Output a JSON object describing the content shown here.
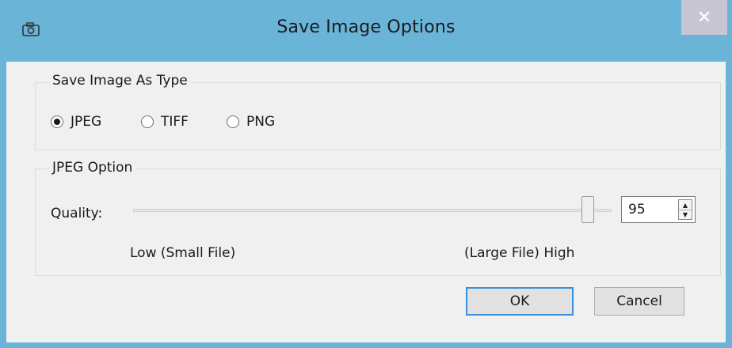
{
  "window": {
    "title": "Save Image Options",
    "close_glyph": "✕",
    "icon": "camera-icon"
  },
  "type_group": {
    "legend": "Save Image As Type",
    "options": [
      {
        "label": "JPEG",
        "checked": true
      },
      {
        "label": "TIFF",
        "checked": false
      },
      {
        "label": "PNG",
        "checked": false
      }
    ]
  },
  "jpeg_group": {
    "legend": "JPEG Option",
    "quality_label": "Quality:",
    "low_label": "Low (Small File)",
    "high_label": "(Large File) High",
    "slider_min": 0,
    "slider_max": 100,
    "quality_value": "95"
  },
  "buttons": {
    "ok": "OK",
    "cancel": "Cancel"
  },
  "colors": {
    "titlebar": "#6ab4d8",
    "client_bg": "#f0f0f0",
    "ok_focus_border": "#3c8fd6"
  }
}
